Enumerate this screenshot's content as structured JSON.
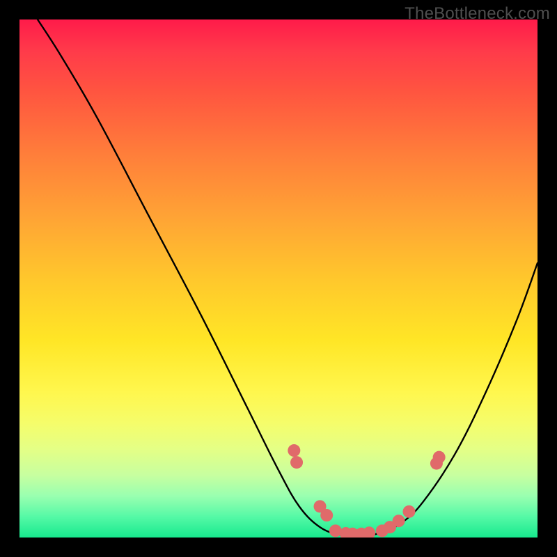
{
  "watermark": "TheBottleneck.com",
  "chart_data": {
    "type": "line",
    "title": "",
    "xlabel": "",
    "ylabel": "",
    "xlim": [
      0,
      100
    ],
    "ylim": [
      0,
      100
    ],
    "grid": false,
    "curve_points": [
      {
        "x": 3.5,
        "y": 100
      },
      {
        "x": 8,
        "y": 93
      },
      {
        "x": 15,
        "y": 81
      },
      {
        "x": 25,
        "y": 62
      },
      {
        "x": 35,
        "y": 43
      },
      {
        "x": 44,
        "y": 25
      },
      {
        "x": 50,
        "y": 13
      },
      {
        "x": 54,
        "y": 6
      },
      {
        "x": 58,
        "y": 2
      },
      {
        "x": 62,
        "y": 0.5
      },
      {
        "x": 66,
        "y": 0.3
      },
      {
        "x": 70,
        "y": 1
      },
      {
        "x": 74,
        "y": 3
      },
      {
        "x": 78,
        "y": 7
      },
      {
        "x": 84,
        "y": 16
      },
      {
        "x": 90,
        "y": 28
      },
      {
        "x": 96,
        "y": 42
      },
      {
        "x": 100,
        "y": 53
      }
    ],
    "markers": [
      {
        "x": 53.0,
        "y": 16.8
      },
      {
        "x": 53.5,
        "y": 14.5
      },
      {
        "x": 58.0,
        "y": 6.0
      },
      {
        "x": 59.3,
        "y": 4.3
      },
      {
        "x": 61.0,
        "y": 1.3
      },
      {
        "x": 63.0,
        "y": 0.8
      },
      {
        "x": 64.3,
        "y": 0.7
      },
      {
        "x": 66.0,
        "y": 0.7
      },
      {
        "x": 67.5,
        "y": 0.9
      },
      {
        "x": 70.0,
        "y": 1.3
      },
      {
        "x": 71.5,
        "y": 2.0
      },
      {
        "x": 73.2,
        "y": 3.2
      },
      {
        "x": 75.2,
        "y": 5.0
      },
      {
        "x": 80.5,
        "y": 14.3
      },
      {
        "x": 81.0,
        "y": 15.5
      }
    ],
    "curve_color": "#000000",
    "marker_color": "#e06a6a",
    "marker_radius_px": 9
  }
}
